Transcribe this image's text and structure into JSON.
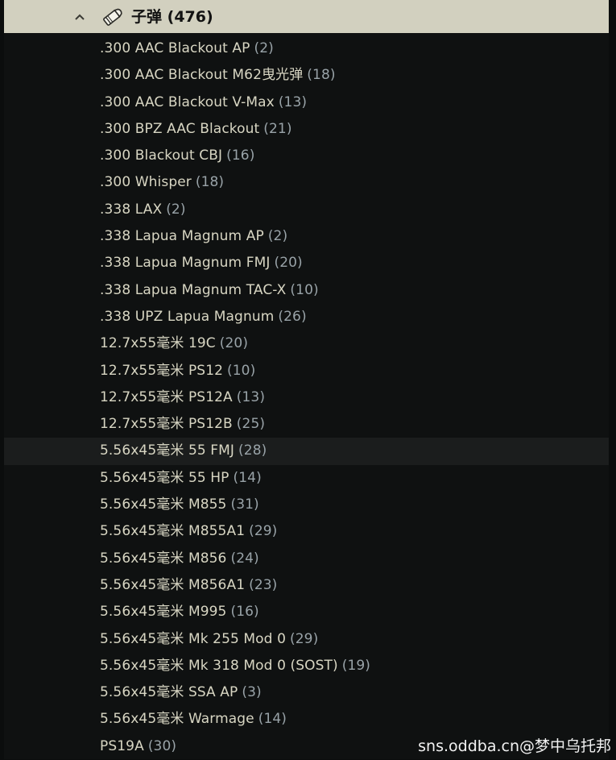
{
  "header": {
    "title": "子弹",
    "count": "(476)",
    "chevron_icon": "chevron-up-icon",
    "category_icon": "ammo-icon",
    "bg_color": "#d2d0bf"
  },
  "items": [
    {
      "name": ".300 AAC Blackout AP",
      "count": "(2)"
    },
    {
      "name": ".300 AAC Blackout M62曳光弹",
      "count": "(18)"
    },
    {
      "name": ".300 AAC Blackout V-Max",
      "count": "(13)"
    },
    {
      "name": ".300 BPZ AAC Blackout",
      "count": "(21)"
    },
    {
      "name": ".300 Blackout CBJ",
      "count": "(16)"
    },
    {
      "name": ".300 Whisper",
      "count": "(18)"
    },
    {
      "name": ".338 LAX",
      "count": "(2)"
    },
    {
      "name": ".338 Lapua Magnum AP",
      "count": "(2)"
    },
    {
      "name": ".338 Lapua Magnum FMJ",
      "count": "(20)"
    },
    {
      "name": ".338 Lapua Magnum TAC-X",
      "count": "(10)"
    },
    {
      "name": ".338 UPZ Lapua Magnum",
      "count": "(26)"
    },
    {
      "name": "12.7x55毫米 19C",
      "count": "(20)"
    },
    {
      "name": "12.7x55毫米 PS12",
      "count": "(10)"
    },
    {
      "name": "12.7x55毫米 PS12A",
      "count": "(13)"
    },
    {
      "name": "12.7x55毫米 PS12B",
      "count": "(25)"
    },
    {
      "name": "5.56x45毫米 55 FMJ",
      "count": "(28)"
    },
    {
      "name": "5.56x45毫米 55 HP",
      "count": "(14)"
    },
    {
      "name": "5.56x45毫米 M855",
      "count": "(31)"
    },
    {
      "name": "5.56x45毫米 M855A1",
      "count": "(29)"
    },
    {
      "name": "5.56x45毫米 M856",
      "count": "(24)"
    },
    {
      "name": "5.56x45毫米 M856A1",
      "count": "(23)"
    },
    {
      "name": "5.56x45毫米 M995",
      "count": "(16)"
    },
    {
      "name": "5.56x45毫米 Mk 255 Mod 0",
      "count": "(29)"
    },
    {
      "name": "5.56x45毫米 Mk 318 Mod 0 (SOST)",
      "count": "(19)"
    },
    {
      "name": "5.56x45毫米 SSA AP",
      "count": "(3)"
    },
    {
      "name": "5.56x45毫米 Warmage",
      "count": "(14)"
    },
    {
      "name": "PS19A",
      "count": "(30)"
    }
  ],
  "highlighted_item": "5.56x45毫米 55 FMJ",
  "watermark": "sns.oddba.cn@梦中乌托邦"
}
